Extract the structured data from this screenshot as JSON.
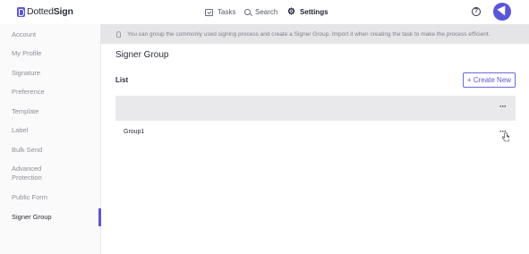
{
  "header": {
    "logo": {
      "prefix": "Dotted",
      "suffix": "Sign"
    },
    "nav": [
      {
        "label": "Tasks",
        "icon": "tasks-icon"
      },
      {
        "label": "Search",
        "icon": "search-icon"
      },
      {
        "label": "Settings",
        "icon": "gear-icon"
      }
    ],
    "help_icon": "?",
    "accent": "#5b57d6"
  },
  "sidebar": {
    "items": [
      {
        "label": "Account"
      },
      {
        "label": "My Profile"
      },
      {
        "label": "Signature"
      },
      {
        "label": "Preference"
      },
      {
        "label": "Template"
      },
      {
        "label": "Label"
      },
      {
        "label": "Bulk Send"
      },
      {
        "label": "Advanced",
        "label2": "Protection"
      },
      {
        "label": "Public Form"
      },
      {
        "label": "Signer Group",
        "active": true
      }
    ]
  },
  "banner": {
    "text": "You can group the commonly used signing process and create a Signer Group. Import it when creating the task to make the process efficient."
  },
  "main": {
    "title": "Signer Group",
    "list_label": "List",
    "create_button": "+ Create New",
    "header_menu": "···",
    "rows": [
      {
        "name": "Group1",
        "menu": "···"
      }
    ]
  }
}
